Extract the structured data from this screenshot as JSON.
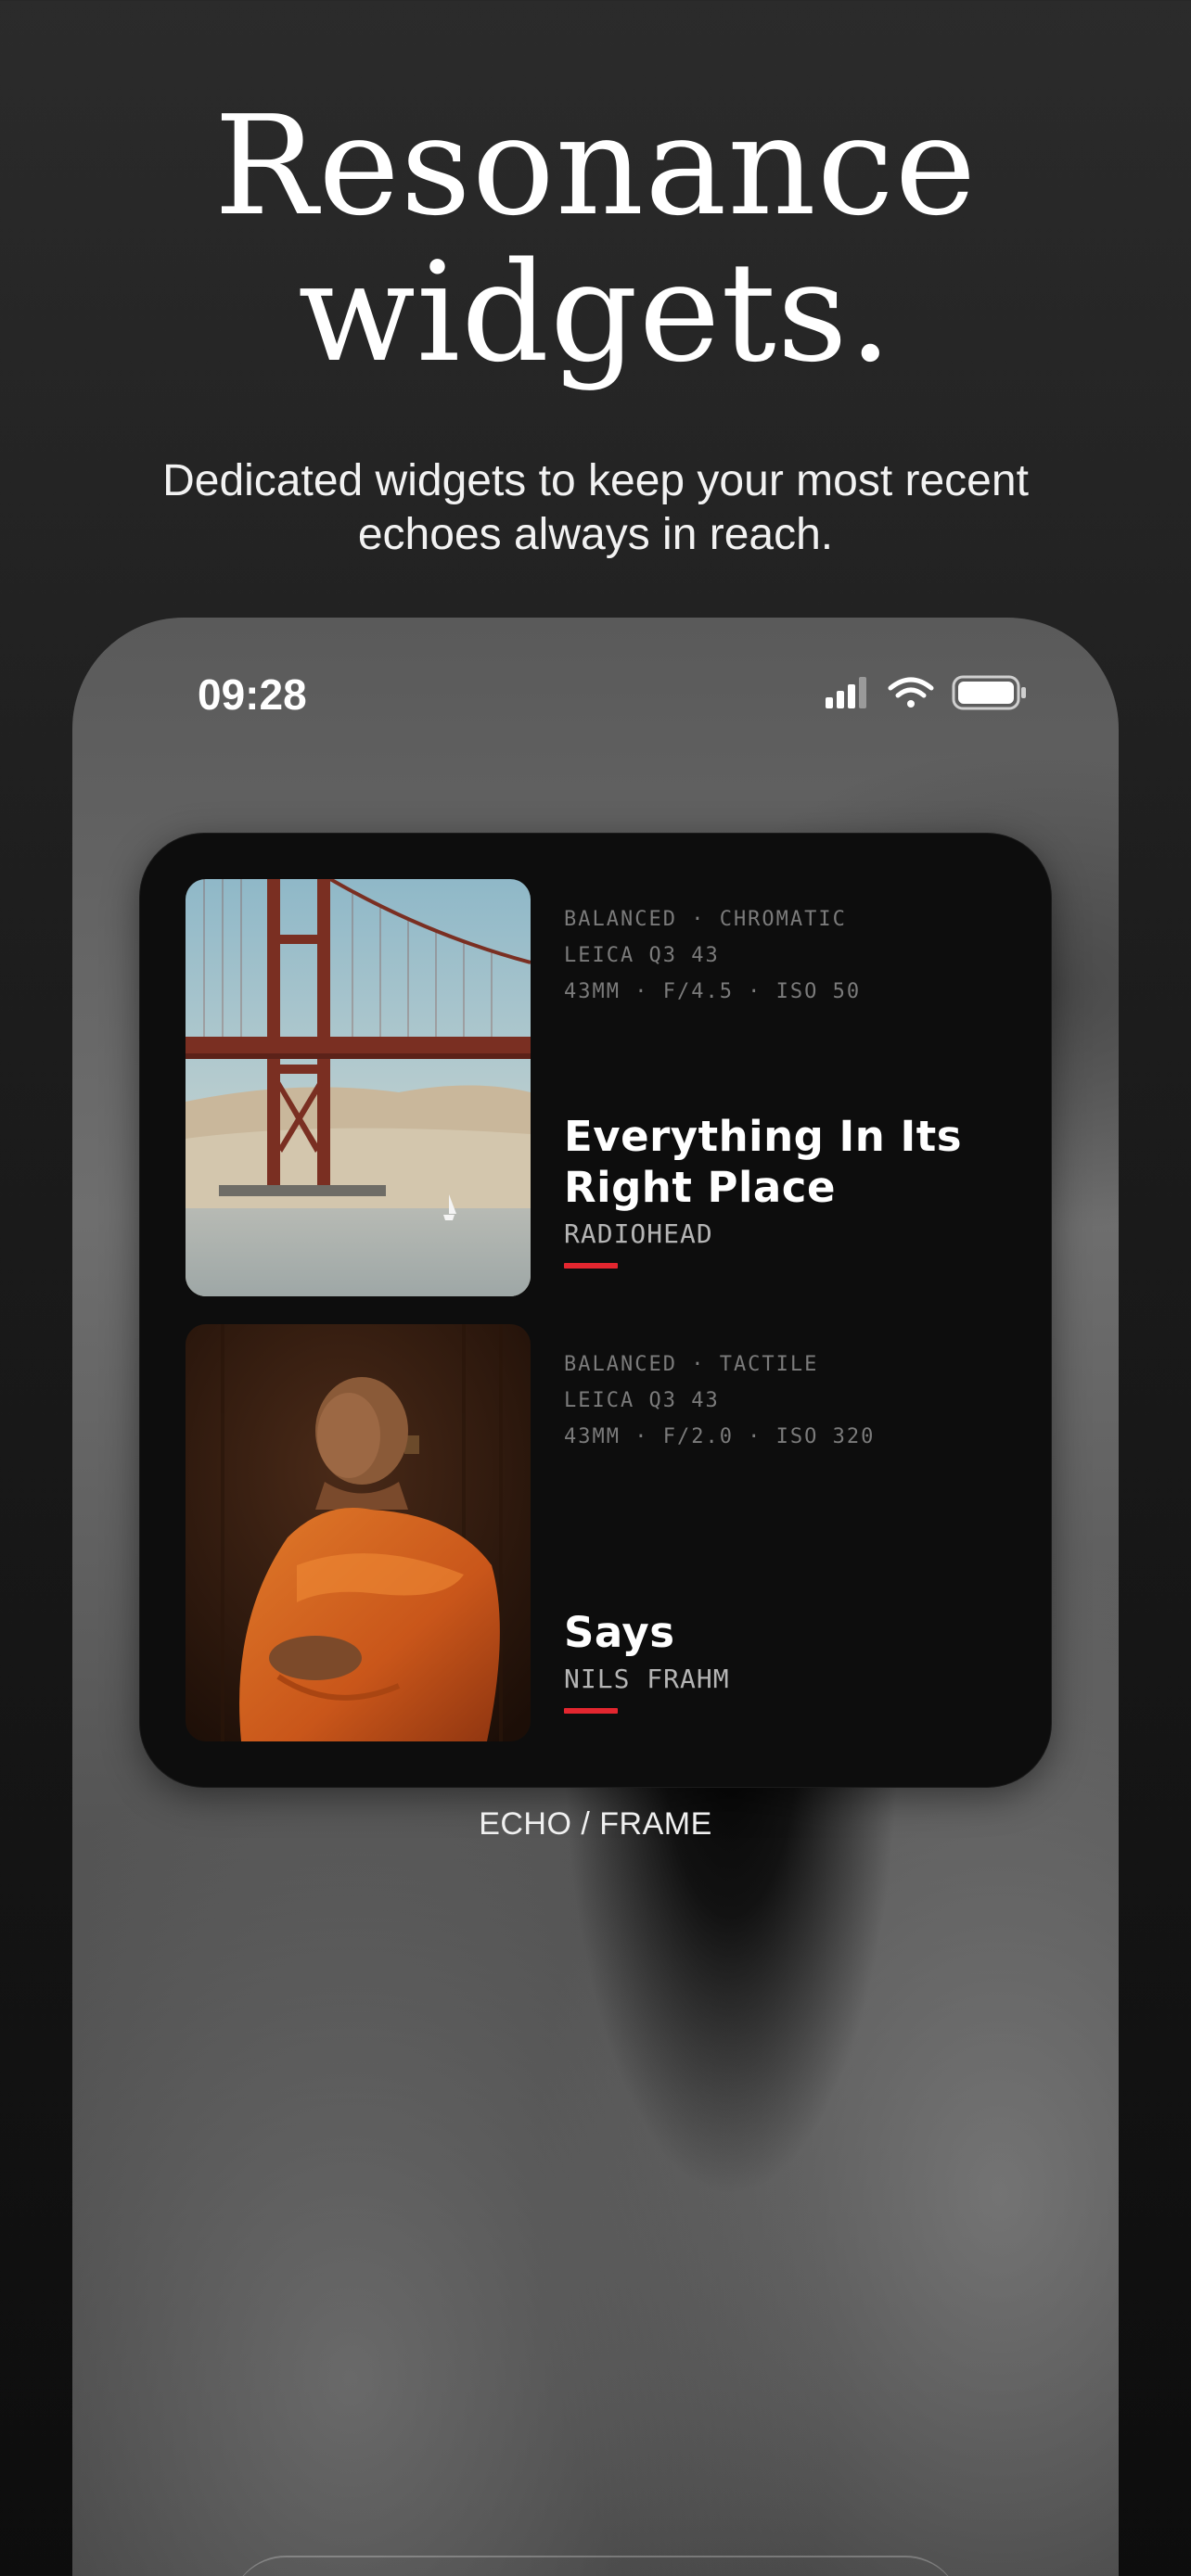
{
  "hero": {
    "title_line1": "Resonance",
    "title_line2": "widgets.",
    "subtitle_line1": "Dedicated widgets to keep your most recent",
    "subtitle_line2": "echoes always in reach."
  },
  "status_bar": {
    "time": "09:28",
    "icons": [
      "cellular-signal-icon",
      "wifi-icon",
      "battery-icon"
    ]
  },
  "widget": {
    "caption": "ECHO / FRAME",
    "accent_color": "#e3262f",
    "entries": [
      {
        "tags": "BALANCED · CHROMATIC",
        "camera": "LEICA Q3 43",
        "settings": "43MM · F/4.5 · ISO 50",
        "title_line1": "Everything In Its",
        "title_line2": "Right Place",
        "artist": "RADIOHEAD",
        "image": "golden-gate-bridge-photo"
      },
      {
        "tags": "BALANCED · TACTILE",
        "camera": "LEICA Q3 43",
        "settings": "43MM · F/2.0 · ISO 320",
        "title_line1": "Says",
        "artist": "NILS FRAHM",
        "image": "monk-portrait-photo"
      }
    ]
  }
}
